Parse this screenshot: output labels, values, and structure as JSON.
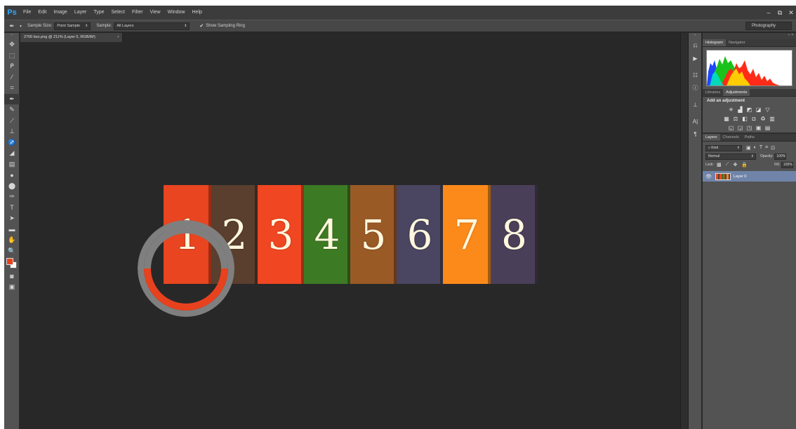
{
  "menubar": {
    "logo": "Ps",
    "items": [
      "File",
      "Edit",
      "Image",
      "Layer",
      "Type",
      "Select",
      "Filter",
      "View",
      "Window",
      "Help"
    ],
    "window_controls": [
      "–",
      "⧉",
      "✕"
    ]
  },
  "options": {
    "sample_size_label": "Sample Size:",
    "sample_size_value": "Point Sample",
    "sample_label": "Sample:",
    "sample_value": "All Layers",
    "show_ring_label": "Show Sampling Ring",
    "show_ring_checked": true,
    "workspace": "Photography"
  },
  "document": {
    "tab_title": "2700 bez.png @ 211% (Layer 0, RGB/8#)",
    "close_glyph": "×"
  },
  "image": {
    "books": [
      {
        "number": "1",
        "color": "#e84520"
      },
      {
        "number": "2",
        "color": "#5a3e2e"
      },
      {
        "number": "3",
        "color": "#f04622"
      },
      {
        "number": "4",
        "color": "#3d7a24"
      },
      {
        "number": "5",
        "color": "#9a5a26"
      },
      {
        "number": "6",
        "color": "#4a4560"
      },
      {
        "number": "7",
        "color": "#fb8a1a"
      },
      {
        "number": "8",
        "color": "#4a3f58"
      }
    ],
    "ring_new_color": "#e8411e",
    "ring_old_color": "#7f7f7f"
  },
  "panels": {
    "histogram_tabs": [
      "Histogram",
      "Navigator"
    ],
    "adjust_tabs": [
      "Libraries",
      "Adjustments"
    ],
    "adjust_title": "Add an adjustment",
    "layers_tabs": [
      "Layers",
      "Channels",
      "Paths"
    ],
    "filter_kind": "Kind",
    "blend_mode": "Normal",
    "opacity_label": "Opacity:",
    "opacity_value": "100%",
    "lock_label": "Lock:",
    "fill_label": "Fill:",
    "fill_value": "100%",
    "layer_name": "Layer 0"
  },
  "colors": {
    "foreground": "#e8411e",
    "background": "#ffffff",
    "accent": "#31a8ff"
  }
}
